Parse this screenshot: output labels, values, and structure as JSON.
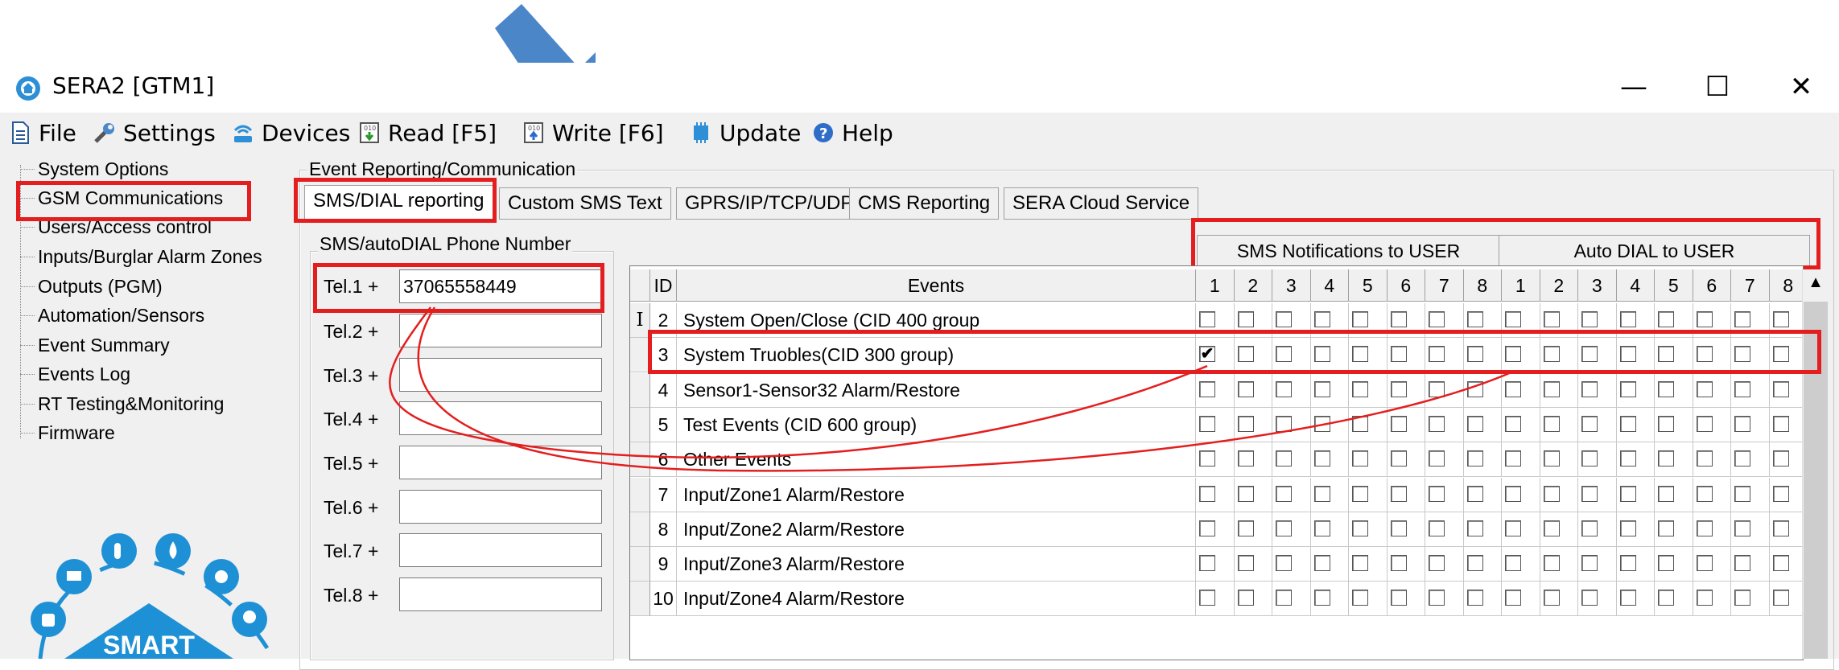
{
  "window": {
    "title": "SERA2 [GTM1]",
    "minimize": "—",
    "maximize": "☐",
    "close": "✕"
  },
  "menu": {
    "file": "File",
    "settings": "Settings",
    "devices": "Devices",
    "read": "Read [F5]",
    "write": "Write [F6]",
    "update": "Update",
    "help": "Help"
  },
  "tree": [
    "System Options",
    "GSM Communications",
    "Users/Access control",
    "Inputs/Burglar Alarm Zones",
    "Outputs (PGM)",
    "Automation/Sensors",
    "Event Summary",
    "Events Log",
    "RT Testing&Monitoring",
    "Firmware"
  ],
  "logo": {
    "text": "SMART"
  },
  "group_main": "Event Reporting/Communication",
  "tabs": [
    "SMS/DIAL reporting",
    "Custom SMS Text",
    "GPRS/IP/TCP/UDP",
    "CMS Reporting",
    "SERA Cloud Service"
  ],
  "phone_group": "SMS/autoDIAL Phone Number",
  "tels": [
    {
      "label": "Tel.1  +",
      "value": "37065558449"
    },
    {
      "label": "Tel.2  +",
      "value": ""
    },
    {
      "label": "Tel.3  +",
      "value": ""
    },
    {
      "label": "Tel.4  +",
      "value": ""
    },
    {
      "label": "Tel.5  +",
      "value": ""
    },
    {
      "label": "Tel.6  +",
      "value": ""
    },
    {
      "label": "Tel.7  +",
      "value": ""
    },
    {
      "label": "Tel.8  +",
      "value": ""
    }
  ],
  "grid": {
    "group_sms": "SMS Notifications to USER",
    "group_dial": "Auto DIAL to USER",
    "col_id": "ID",
    "col_events": "Events",
    "user_cols": [
      "1",
      "2",
      "3",
      "4",
      "5",
      "6",
      "7",
      "8"
    ],
    "rows": [
      {
        "id": "2",
        "event": "System Open/Close (CID 400 group",
        "checked": []
      },
      {
        "id": "3",
        "event": "System Truobles(CID 300 group)",
        "checked": [
          0
        ]
      },
      {
        "id": "4",
        "event": "Sensor1-Sensor32 Alarm/Restore",
        "checked": []
      },
      {
        "id": "5",
        "event": "Test Events (CID 600 group)",
        "checked": []
      },
      {
        "id": "6",
        "event": "Other Events",
        "checked": []
      },
      {
        "id": "7",
        "event": "Input/Zone1 Alarm/Restore",
        "checked": []
      },
      {
        "id": "8",
        "event": "Input/Zone2 Alarm/Restore",
        "checked": []
      },
      {
        "id": "9",
        "event": "Input/Zone3 Alarm/Restore",
        "checked": []
      },
      {
        "id": "10",
        "event": "Input/Zone4 Alarm/Restore",
        "checked": []
      }
    ]
  },
  "colors": {
    "highlight": "#e41e1e",
    "arrow": "#4a86c8",
    "logo": "#1e90d6"
  }
}
